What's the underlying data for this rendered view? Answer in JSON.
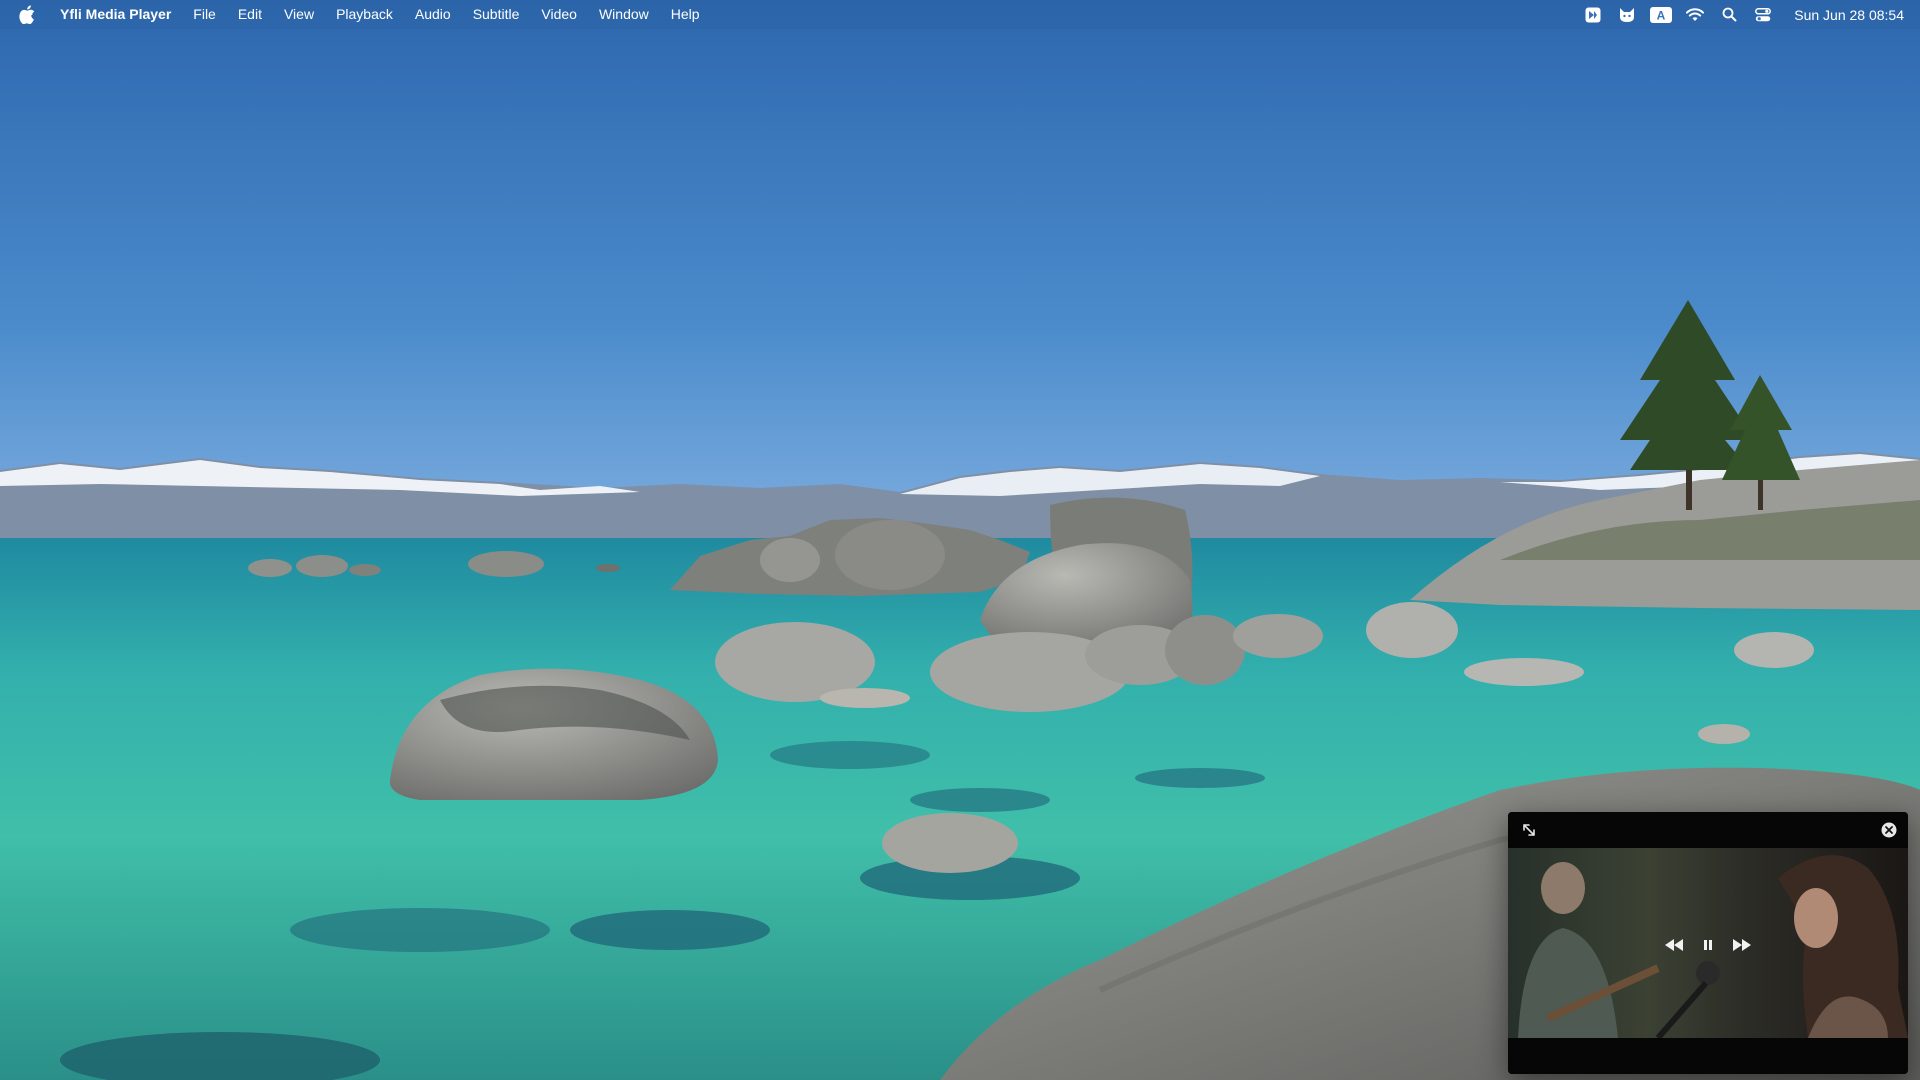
{
  "menubar": {
    "app_name": "Yfli Media Player",
    "menus": [
      "File",
      "Edit",
      "View",
      "Playback",
      "Audio",
      "Subtitle",
      "Video",
      "Window",
      "Help"
    ],
    "status_icons": [
      "bird-app-icon",
      "cat-app-icon",
      "input-source-icon",
      "wifi-icon",
      "spotlight-search-icon",
      "control-center-icon"
    ],
    "input_source_letter": "A",
    "clock": "Sun Jun 28  08:54"
  },
  "mini_player": {
    "state": "playing",
    "controls": [
      "rewind",
      "pause",
      "fast-forward"
    ]
  },
  "colors": {
    "sky": "#3f7fc4",
    "water": "#2fa3a4",
    "player_bg": "#0b0b0c"
  }
}
